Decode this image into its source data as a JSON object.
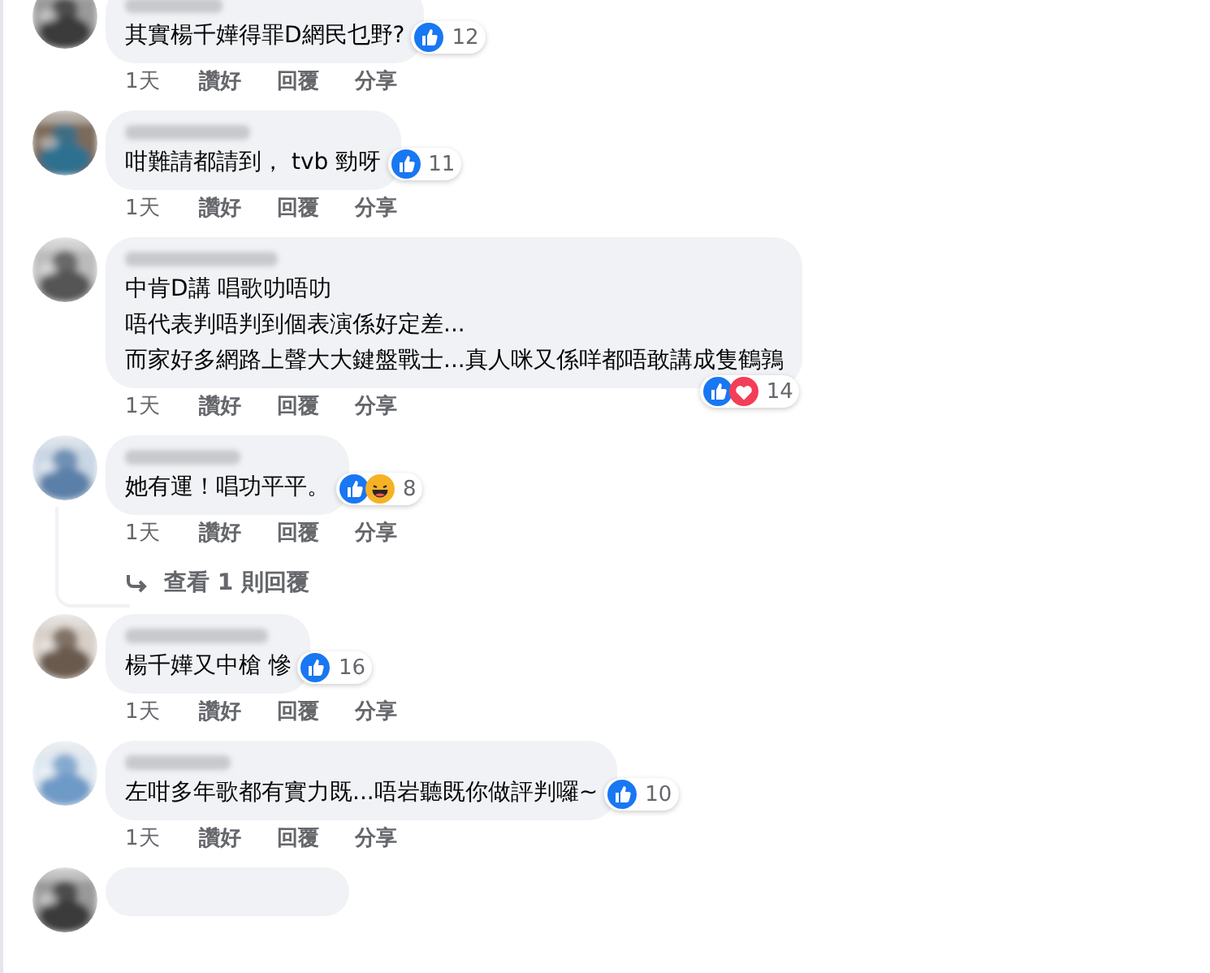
{
  "comments": [
    {
      "lines": [
        "其實楊千嬅得罪D網民乜野?"
      ],
      "reactions": [
        {
          "kind": "like"
        }
      ],
      "reaction_count": "12",
      "actions": [
        "1天",
        "讚好",
        "回覆",
        "分享"
      ]
    },
    {
      "lines": [
        "咁難請都請到， tvb 勁呀"
      ],
      "reactions": [
        {
          "kind": "like"
        }
      ],
      "reaction_count": "11",
      "actions": [
        "1天",
        "讚好",
        "回覆",
        "分享"
      ]
    },
    {
      "lines": [
        "中肯D講 唱歌叻唔叻",
        "唔代表判唔判到個表演係好定差...",
        "而家好多網路上聲大大鍵盤戰士...真人咪又係咩都唔敢講成隻鶴鶉"
      ],
      "reactions": [
        {
          "kind": "like"
        },
        {
          "kind": "love"
        }
      ],
      "reaction_count": "14",
      "actions": [
        "1天",
        "讚好",
        "回覆",
        "分享"
      ]
    },
    {
      "lines": [
        "她有運！唱功平平。"
      ],
      "reactions": [
        {
          "kind": "like"
        },
        {
          "kind": "haha"
        }
      ],
      "reaction_count": "8",
      "actions": [
        "1天",
        "讚好",
        "回覆",
        "分享"
      ],
      "replies_link": "查看 1 則回覆"
    },
    {
      "lines": [
        "楊千嬅又中槍 慘"
      ],
      "reactions": [
        {
          "kind": "like"
        }
      ],
      "reaction_count": "16",
      "actions": [
        "1天",
        "讚好",
        "回覆",
        "分享"
      ]
    },
    {
      "lines": [
        "左咁多年歌都有實力既...唔岩聽既你做評判囉~"
      ],
      "reactions": [
        {
          "kind": "like"
        }
      ],
      "reaction_count": "10",
      "actions": [
        "1天",
        "讚好",
        "回覆",
        "分享"
      ]
    }
  ],
  "more_below": true
}
